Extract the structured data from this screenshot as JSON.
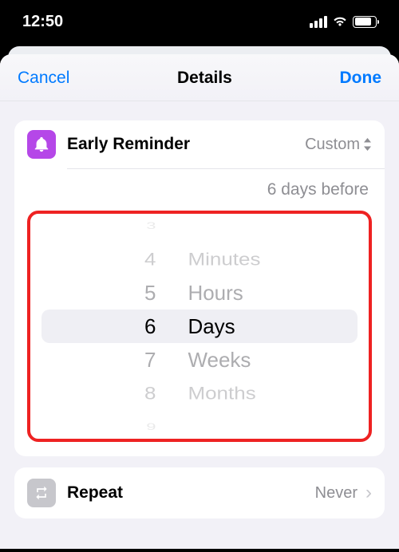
{
  "status": {
    "time": "12:50"
  },
  "nav": {
    "cancel": "Cancel",
    "title": "Details",
    "done": "Done"
  },
  "reminder": {
    "label": "Early Reminder",
    "value": "Custom",
    "summary": "6 days before"
  },
  "picker": {
    "numbers": [
      "3",
      "4",
      "5",
      "6",
      "7",
      "8",
      "9"
    ],
    "units": [
      "Minutes",
      "Hours",
      "Days",
      "Weeks",
      "Months"
    ],
    "selectedNumberIndex": 3,
    "selectedUnitIndex": 2
  },
  "repeat": {
    "label": "Repeat",
    "value": "Never"
  }
}
